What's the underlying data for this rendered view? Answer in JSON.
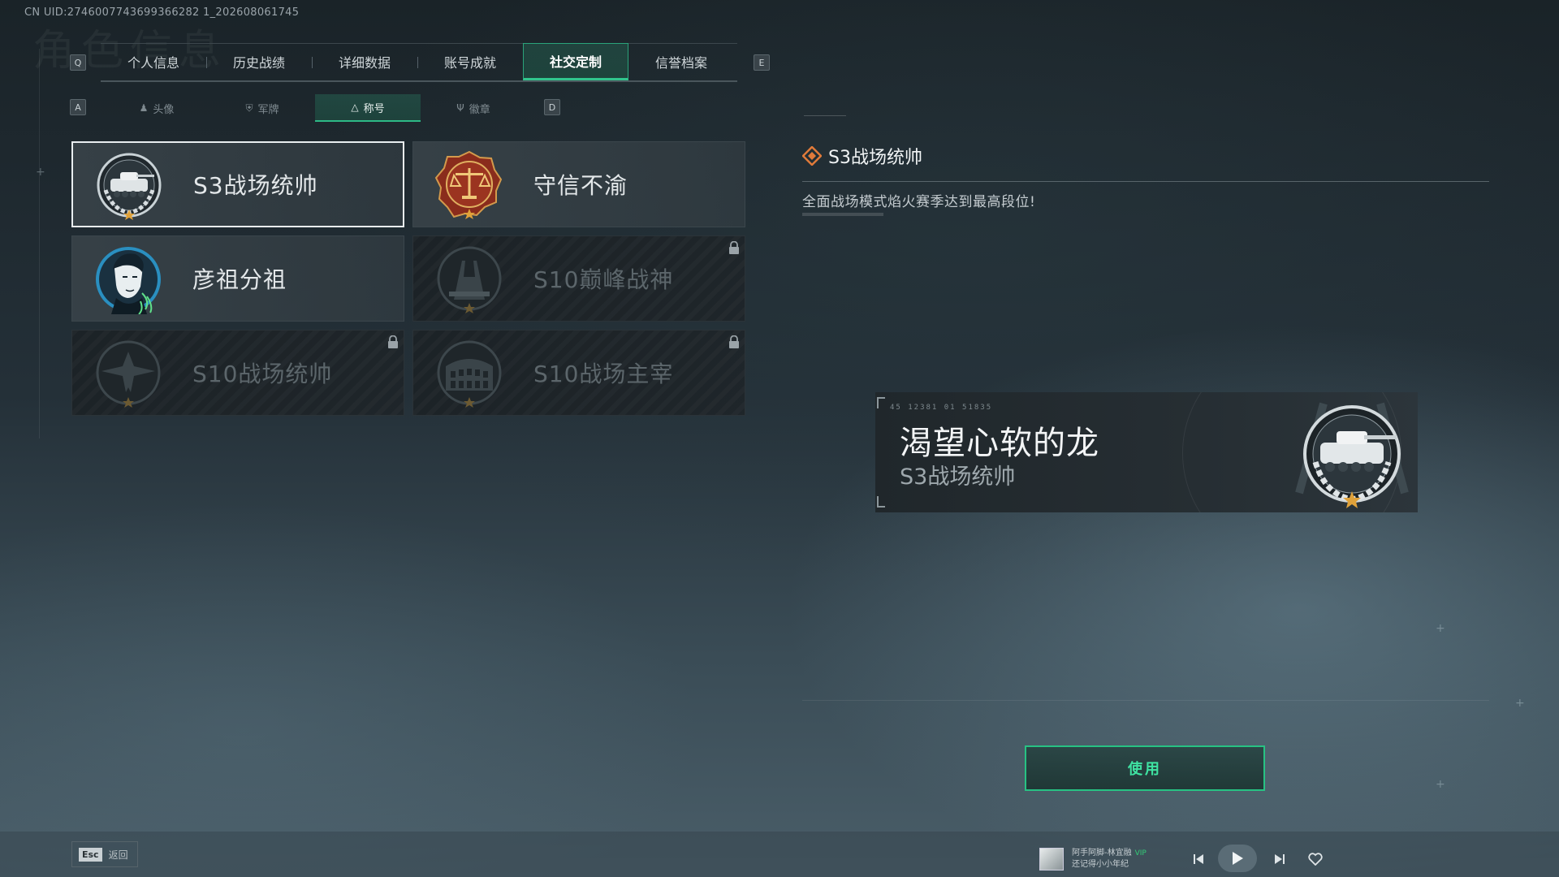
{
  "uid_text": "CN UID:2746007743699366282 1_202608061745",
  "bg_heading": "角色信息",
  "keys": {
    "prev_tab": "Q",
    "next_tab": "E",
    "prev_sub": "A",
    "next_sub": "D"
  },
  "top_tabs": [
    "个人信息",
    "历史战绩",
    "详细数据",
    "账号成就",
    "社交定制",
    "信誉档案"
  ],
  "top_active": "社交定制",
  "sub_tabs": [
    {
      "label": "头像",
      "icon": "person-icon"
    },
    {
      "label": "军牌",
      "icon": "dogtag-icon"
    },
    {
      "label": "称号",
      "icon": "title-triangle-icon"
    },
    {
      "label": "徽章",
      "icon": "emblem-icon"
    }
  ],
  "sub_active": "称号",
  "titles": [
    {
      "name": "S3战场统帅",
      "badge": "tank-wreath-badge-icon",
      "locked": false,
      "selected": true
    },
    {
      "name": "守信不渝",
      "badge": "scales-badge-icon",
      "locked": false,
      "selected": false
    },
    {
      "name": "彦祖分祖",
      "badge": "portrait-badge-icon",
      "locked": false,
      "selected": false
    },
    {
      "name": "S10巅峰战神",
      "badge": "tower-badge-icon",
      "locked": true,
      "selected": false
    },
    {
      "name": "S10战场统帅",
      "badge": "aircraft-badge-icon",
      "locked": true,
      "selected": false
    },
    {
      "name": "S10战场主宰",
      "badge": "colosseum-badge-icon",
      "locked": true,
      "selected": false
    }
  ],
  "detail": {
    "title": "S3战场统帅",
    "description": "全面战场模式焰火赛季达到最高段位!"
  },
  "preview": {
    "code": "45 12381  01 51835",
    "player_name": "渴望心软的龙",
    "title": "S3战场统帅"
  },
  "use_button": "使用",
  "esc": {
    "key": "Esc",
    "label": "返回"
  },
  "music": {
    "line1": "阿手阿脚-林宜融",
    "vip": "VIP",
    "line2": "还记得小小年纪"
  },
  "colors": {
    "accent": "#2db986",
    "button_text": "#3fe3a2",
    "star": "#e0a23a"
  }
}
